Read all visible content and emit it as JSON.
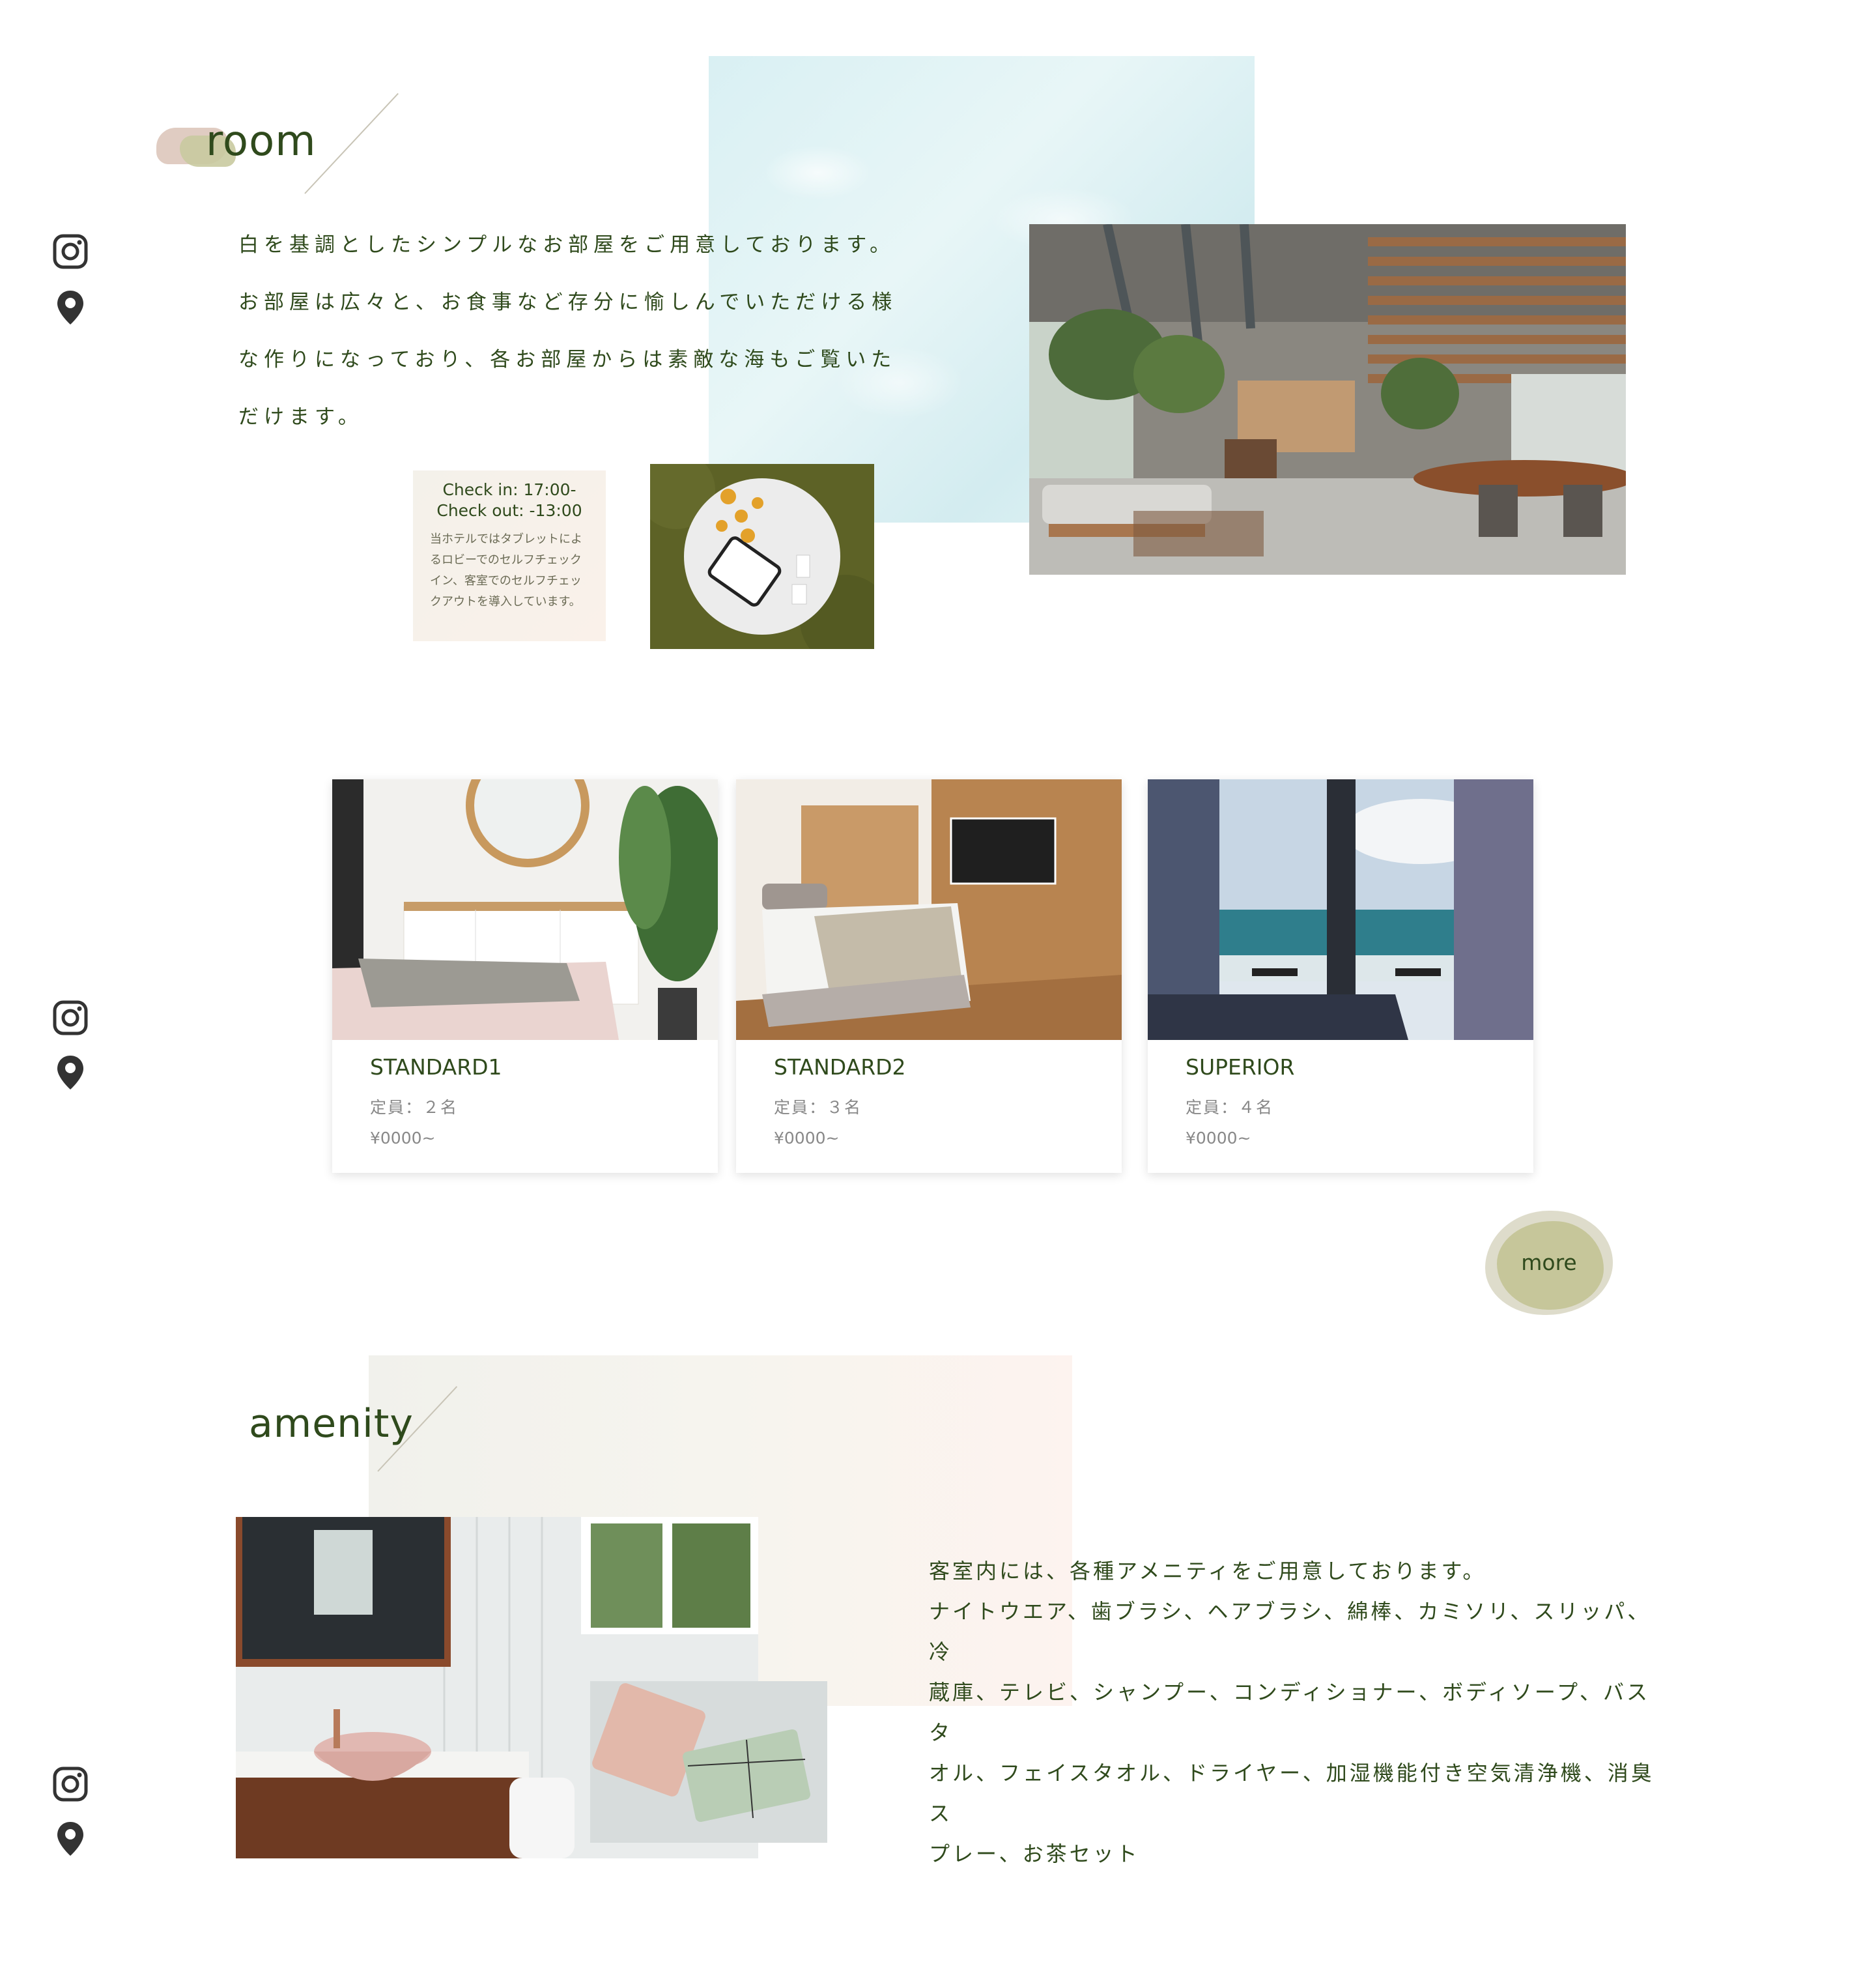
{
  "room": {
    "title": "room",
    "paragraph_lines": [
      "白を基調としたシンプルなお部屋をご用意しております。",
      "お部屋は広々と、お食事など存分に愉しんでいただける様",
      "な作りになっており、各お部屋からは素敵な海もご覧いた",
      "だけます。"
    ],
    "checkin": "Check in: 17:00-",
    "checkout": "Check out: -13:00",
    "checkin_description": "当ホテルではタブレットによるロビーでのセルフチェックイン、客室でのセルフチェックアウトを導入しています。"
  },
  "cards": [
    {
      "name": "STANDARD1",
      "capacity": "定員：２名",
      "price": "¥0000~"
    },
    {
      "name": "STANDARD2",
      "capacity": "定員：３名",
      "price": "¥0000~"
    },
    {
      "name": "SUPERIOR",
      "capacity": "定員：４名",
      "price": "¥0000~"
    }
  ],
  "more_label": "more",
  "amenity": {
    "title": "amenity",
    "paragraph_lines": [
      "客室内には、各種アメニティをご用意しております。",
      "ナイトウエア、歯ブラシ、ヘアブラシ、綿棒、カミソリ、スリッパ、冷",
      "蔵庫、テレビ、シャンプー、コンディショナー、ボディソープ、バスタ",
      "オル、フェイスタオル、ドライヤー、加湿機能付き空気清浄機、消臭ス",
      "プレー、お茶セット"
    ]
  },
  "icons": {
    "instagram": "instagram-icon",
    "location": "map-pin-icon"
  },
  "colors": {
    "text_green": "#2f4a1c",
    "accent_olive": "#c6c69a",
    "muted_gray": "#888888"
  }
}
